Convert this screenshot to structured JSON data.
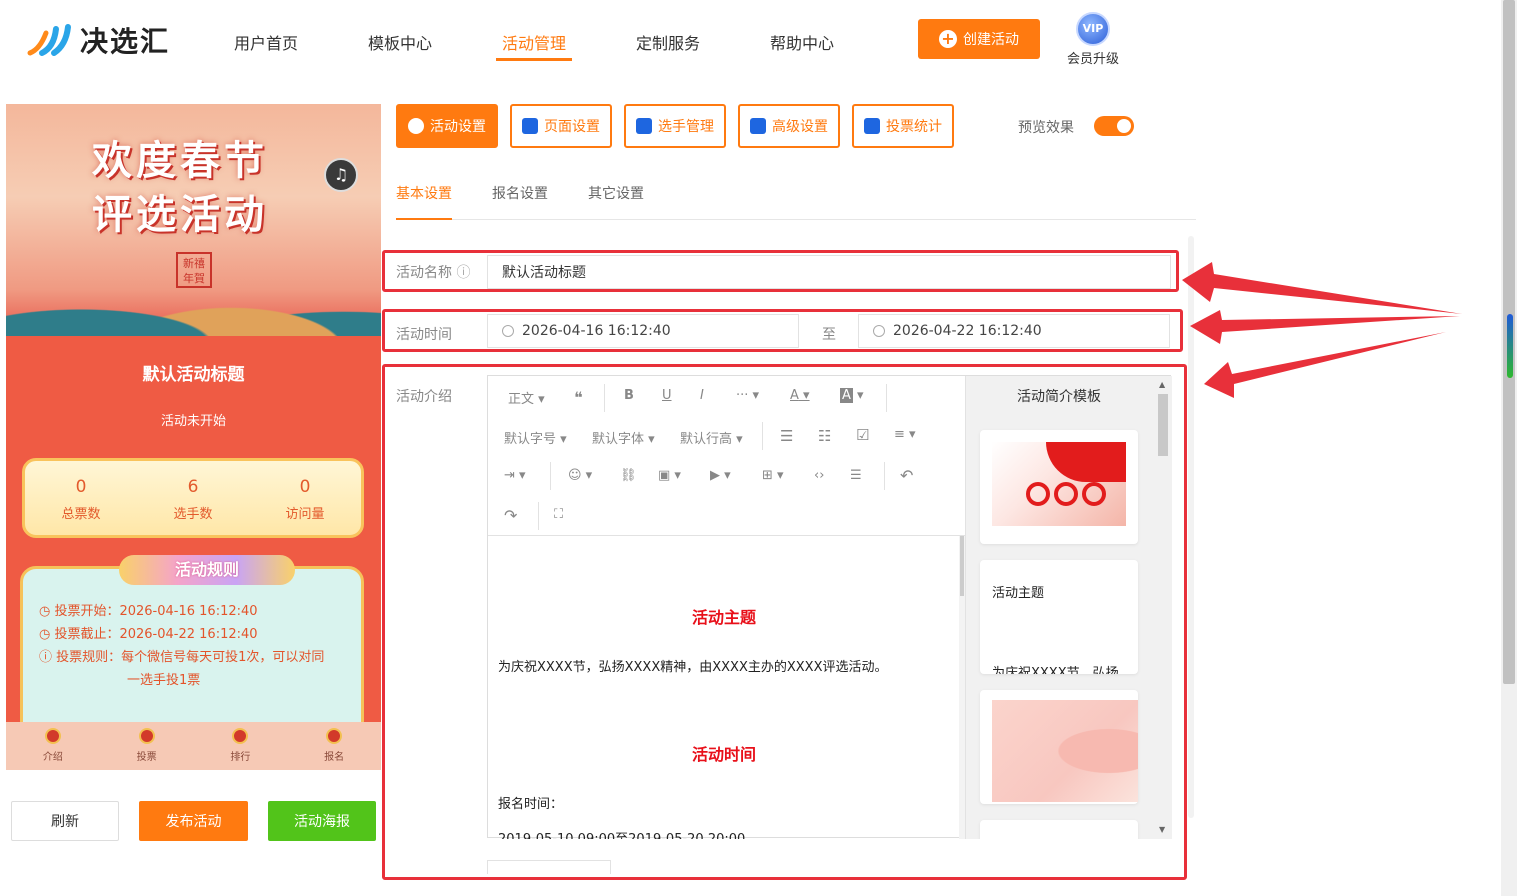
{
  "header": {
    "logo_text": "决选汇",
    "nav": [
      "用户首页",
      "模板中心",
      "活动管理",
      "定制服务",
      "帮助中心"
    ],
    "create_label": "创建活动",
    "vip_badge": "VIP",
    "vip_label": "会员升级"
  },
  "preview": {
    "banner_line1": "欢度春节",
    "banner_line2": "评选活动",
    "seal_text": "新禧年賀",
    "title": "默认活动标题",
    "status": "活动未开始",
    "stats": [
      {
        "value": "0",
        "label": "总票数"
      },
      {
        "value": "6",
        "label": "选手数"
      },
      {
        "value": "0",
        "label": "访问量"
      }
    ],
    "rules_tag": "活动规则",
    "rule_start": "◷ 投票开始：2026-04-16 16:12:40",
    "rule_end": "◷ 投票截止：2026-04-22 16:12:40",
    "rule_desc1": "ⓘ 投票规则：每个微信号每天可投1次，可以对同",
    "rule_desc2": "一选手投1票",
    "tabs": [
      "介绍",
      "投票",
      "排行",
      "报名"
    ]
  },
  "actions": {
    "refresh": "刷新",
    "publish": "发布活动",
    "poster": "活动海报"
  },
  "toolbar_buttons": [
    "活动设置",
    "页面设置",
    "选手管理",
    "高级设置",
    "投票统计"
  ],
  "preview_toggle_label": "预览效果",
  "subtabs": [
    "基本设置",
    "报名设置",
    "其它设置"
  ],
  "form": {
    "name_label": "活动名称",
    "name_value": "默认活动标题",
    "time_label": "活动时间",
    "time_start": "2026-04-16 16:12:40",
    "time_sep": "至",
    "time_end": "2026-04-22 16:12:40",
    "intro_label": "活动介绍"
  },
  "editor": {
    "tools_row1": [
      "正文",
      "❝",
      "B",
      "U",
      "I",
      "···",
      "A",
      "A"
    ],
    "tools_row2": [
      "默认字号",
      "默认字体",
      "默认行高"
    ],
    "heading1": "活动主题",
    "para1": "为庆祝XXXX节，弘扬XXXX精神，由XXXX主办的XXXX评选活动。",
    "heading2": "活动时间",
    "para2": "报名时间：",
    "para3": "2019-05-10 09:00至2019-05-20 20:00",
    "template_title": "活动简介模板",
    "card2_title": "活动主题",
    "card2_text": "为庆祝XXXX节，弘扬"
  }
}
